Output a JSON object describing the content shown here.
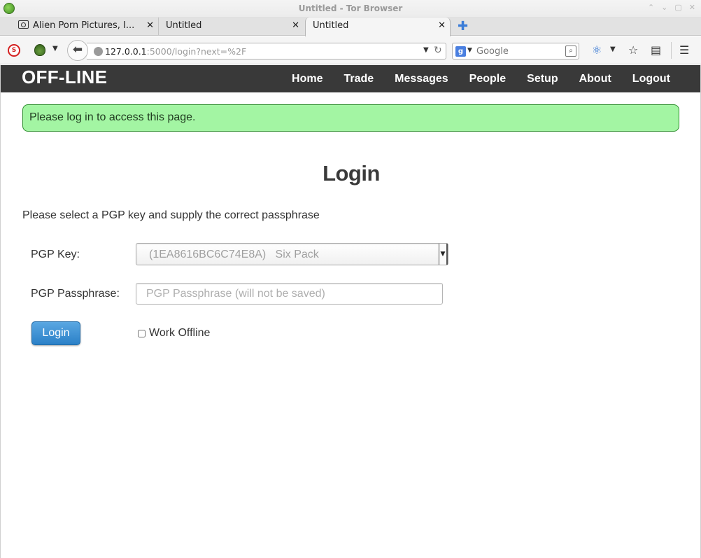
{
  "window": {
    "title": "Untitled - Tor Browser",
    "controls": [
      "⌃",
      "⌄",
      "▢",
      "✕"
    ]
  },
  "tabs": [
    {
      "label": "Alien Porn Pictures, I...",
      "favicon": "camera-icon"
    },
    {
      "label": "Untitled"
    },
    {
      "label": "Untitled",
      "active": true
    }
  ],
  "toolbar": {
    "url_host": "127.0.0.1",
    "url_rest": ":5000/login?next=%2F",
    "search_placeholder": "Google",
    "search_engine": "g"
  },
  "site": {
    "brand": "OFF-LINE",
    "nav": [
      "Home",
      "Trade",
      "Messages",
      "People",
      "Setup",
      "About",
      "Logout"
    ],
    "flash": "Please log in to access this page.",
    "heading": "Login",
    "instructions": "Please select a PGP key and supply the correct passphrase",
    "pgp_key_label": "PGP Key:",
    "pgp_key_selected": "(1EA8616BC6C74E8A)   Six Pack",
    "passphrase_label": "PGP Passphrase:",
    "passphrase_placeholder": "PGP Passphrase (will not be saved)",
    "login_button": "Login",
    "work_offline_label": "Work Offline",
    "work_offline_checked": false
  },
  "colors": {
    "header_bg": "#393939",
    "flash_bg": "#a3f5a3",
    "flash_border": "#2f8f2f",
    "button_blue": "#2b80c7"
  }
}
